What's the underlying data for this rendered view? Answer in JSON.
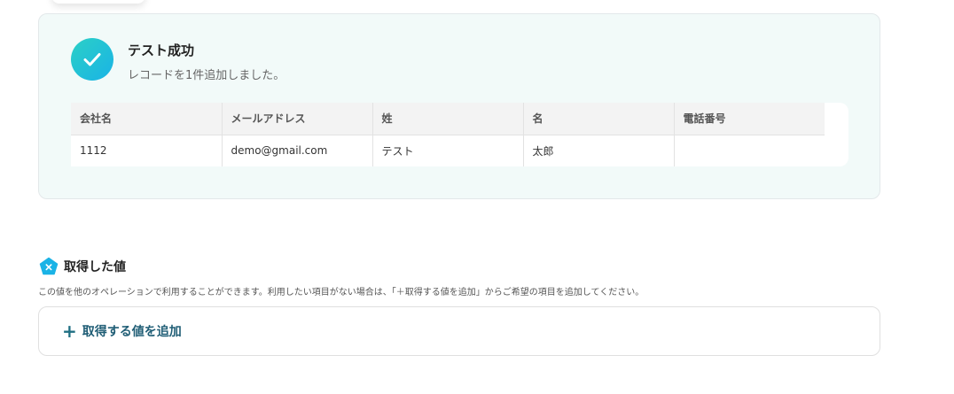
{
  "result": {
    "title": "テスト成功",
    "message": "レコードを1件追加しました。",
    "table": {
      "columns": [
        "会社名",
        "メールアドレス",
        "姓",
        "名",
        "電話番号"
      ],
      "rows": [
        [
          "1112",
          "demo@gmail.com",
          "テスト",
          "太郎",
          ""
        ]
      ]
    }
  },
  "acquired_values": {
    "title": "取得した値",
    "description": "この値を他のオペレーションで利用することができます。利用したい項目がない場合は、「＋取得する値を追加」からご希望の項目を追加してください。",
    "add_button_label": "取得する値を追加"
  },
  "colors": {
    "success_gradient_start": "#2bd0c6",
    "success_gradient_end": "#1ab3e6",
    "card_background": "#f2faf9",
    "accent_text": "#1f5d75",
    "badge_blue": "#1ab3e6"
  },
  "icons": {
    "success": "check-icon",
    "values": "pentagon-x-icon",
    "add": "plus-icon"
  }
}
